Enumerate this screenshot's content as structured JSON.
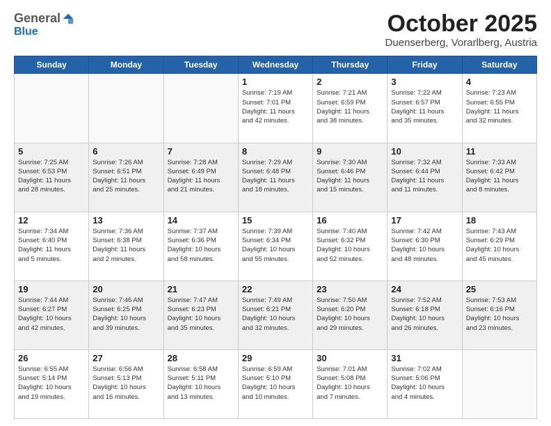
{
  "header": {
    "logo_general": "General",
    "logo_blue": "Blue",
    "month_title": "October 2025",
    "location": "Duenserberg, Vorarlberg, Austria"
  },
  "days_of_week": [
    "Sunday",
    "Monday",
    "Tuesday",
    "Wednesday",
    "Thursday",
    "Friday",
    "Saturday"
  ],
  "weeks": [
    [
      {
        "day": "",
        "info": ""
      },
      {
        "day": "",
        "info": ""
      },
      {
        "day": "",
        "info": ""
      },
      {
        "day": "1",
        "info": "Sunrise: 7:19 AM\nSunset: 7:01 PM\nDaylight: 11 hours\nand 42 minutes."
      },
      {
        "day": "2",
        "info": "Sunrise: 7:21 AM\nSunset: 6:59 PM\nDaylight: 11 hours\nand 38 minutes."
      },
      {
        "day": "3",
        "info": "Sunrise: 7:22 AM\nSunset: 6:57 PM\nDaylight: 11 hours\nand 35 minutes."
      },
      {
        "day": "4",
        "info": "Sunrise: 7:23 AM\nSunset: 6:55 PM\nDaylight: 11 hours\nand 32 minutes."
      }
    ],
    [
      {
        "day": "5",
        "info": "Sunrise: 7:25 AM\nSunset: 6:53 PM\nDaylight: 11 hours\nand 28 minutes."
      },
      {
        "day": "6",
        "info": "Sunrise: 7:26 AM\nSunset: 6:51 PM\nDaylight: 11 hours\nand 25 minutes."
      },
      {
        "day": "7",
        "info": "Sunrise: 7:28 AM\nSunset: 6:49 PM\nDaylight: 11 hours\nand 21 minutes."
      },
      {
        "day": "8",
        "info": "Sunrise: 7:29 AM\nSunset: 6:48 PM\nDaylight: 11 hours\nand 18 minutes."
      },
      {
        "day": "9",
        "info": "Sunrise: 7:30 AM\nSunset: 6:46 PM\nDaylight: 11 hours\nand 15 minutes."
      },
      {
        "day": "10",
        "info": "Sunrise: 7:32 AM\nSunset: 6:44 PM\nDaylight: 11 hours\nand 11 minutes."
      },
      {
        "day": "11",
        "info": "Sunrise: 7:33 AM\nSunset: 6:42 PM\nDaylight: 11 hours\nand 8 minutes."
      }
    ],
    [
      {
        "day": "12",
        "info": "Sunrise: 7:34 AM\nSunset: 6:40 PM\nDaylight: 11 hours\nand 5 minutes."
      },
      {
        "day": "13",
        "info": "Sunrise: 7:36 AM\nSunset: 6:38 PM\nDaylight: 11 hours\nand 2 minutes."
      },
      {
        "day": "14",
        "info": "Sunrise: 7:37 AM\nSunset: 6:36 PM\nDaylight: 10 hours\nand 58 minutes."
      },
      {
        "day": "15",
        "info": "Sunrise: 7:39 AM\nSunset: 6:34 PM\nDaylight: 10 hours\nand 55 minutes."
      },
      {
        "day": "16",
        "info": "Sunrise: 7:40 AM\nSunset: 6:32 PM\nDaylight: 10 hours\nand 52 minutes."
      },
      {
        "day": "17",
        "info": "Sunrise: 7:42 AM\nSunset: 6:30 PM\nDaylight: 10 hours\nand 48 minutes."
      },
      {
        "day": "18",
        "info": "Sunrise: 7:43 AM\nSunset: 6:29 PM\nDaylight: 10 hours\nand 45 minutes."
      }
    ],
    [
      {
        "day": "19",
        "info": "Sunrise: 7:44 AM\nSunset: 6:27 PM\nDaylight: 10 hours\nand 42 minutes."
      },
      {
        "day": "20",
        "info": "Sunrise: 7:46 AM\nSunset: 6:25 PM\nDaylight: 10 hours\nand 39 minutes."
      },
      {
        "day": "21",
        "info": "Sunrise: 7:47 AM\nSunset: 6:23 PM\nDaylight: 10 hours\nand 35 minutes."
      },
      {
        "day": "22",
        "info": "Sunrise: 7:49 AM\nSunset: 6:21 PM\nDaylight: 10 hours\nand 32 minutes."
      },
      {
        "day": "23",
        "info": "Sunrise: 7:50 AM\nSunset: 6:20 PM\nDaylight: 10 hours\nand 29 minutes."
      },
      {
        "day": "24",
        "info": "Sunrise: 7:52 AM\nSunset: 6:18 PM\nDaylight: 10 hours\nand 26 minutes."
      },
      {
        "day": "25",
        "info": "Sunrise: 7:53 AM\nSunset: 6:16 PM\nDaylight: 10 hours\nand 23 minutes."
      }
    ],
    [
      {
        "day": "26",
        "info": "Sunrise: 6:55 AM\nSunset: 5:14 PM\nDaylight: 10 hours\nand 19 minutes."
      },
      {
        "day": "27",
        "info": "Sunrise: 6:56 AM\nSunset: 5:13 PM\nDaylight: 10 hours\nand 16 minutes."
      },
      {
        "day": "28",
        "info": "Sunrise: 6:58 AM\nSunset: 5:11 PM\nDaylight: 10 hours\nand 13 minutes."
      },
      {
        "day": "29",
        "info": "Sunrise: 6:59 AM\nSunset: 5:10 PM\nDaylight: 10 hours\nand 10 minutes."
      },
      {
        "day": "30",
        "info": "Sunrise: 7:01 AM\nSunset: 5:08 PM\nDaylight: 10 hours\nand 7 minutes."
      },
      {
        "day": "31",
        "info": "Sunrise: 7:02 AM\nSunset: 5:06 PM\nDaylight: 10 hours\nand 4 minutes."
      },
      {
        "day": "",
        "info": ""
      }
    ]
  ]
}
